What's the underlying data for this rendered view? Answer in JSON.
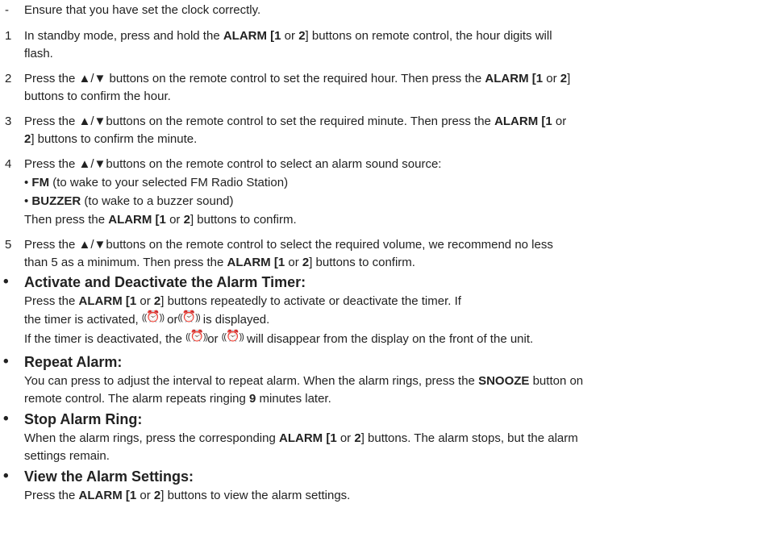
{
  "steps": {
    "prereq": {
      "marker": "-",
      "text": "Ensure that you have set the clock correctly."
    },
    "s1": {
      "marker": "1",
      "a": "In standby mode, press and hold the ",
      "b": "ALARM [1",
      "c": " or ",
      "d": "2",
      "e": "] buttons on remote control, the hour digits will",
      "f": "flash."
    },
    "s2": {
      "marker": "2",
      "a": "Press the ▲/▼ buttons on the remote control to set the required hour. Then press the ",
      "b": "ALARM [1",
      "c": " or ",
      "d": "2",
      "e": "]",
      "f": "buttons to confirm the hour."
    },
    "s3": {
      "marker": "3",
      "a": "Press the ▲/▼buttons on the remote control to set the required minute. Then press the ",
      "b": "ALARM [1",
      "c": " or",
      "d": "2",
      "e": "] buttons to confirm the minute."
    },
    "s4": {
      "marker": "4",
      "a": "Press the ▲/▼buttons on the remote control to select an alarm sound source:",
      "fm_bullet": "• ",
      "fm_label": "FM",
      "fm_text": " (to wake to your selected FM Radio Station)",
      "bz_bullet": "• ",
      "bz_label": "BUZZER",
      "bz_text": " (to wake to a buzzer sound)",
      "then_a": "Then press the ",
      "then_b": "ALARM [1",
      "then_c": " or ",
      "then_d": "2",
      "then_e": "] buttons to confirm."
    },
    "s5": {
      "marker": "5",
      "a": "Press the ▲/▼buttons on the remote control to select the required volume, we recommend no less",
      "b": "than 5 as a minimum. Then press the ",
      "c": "ALARM [1",
      "d": " or ",
      "e": "2",
      "f": "] buttons to confirm."
    }
  },
  "sections": {
    "activate": {
      "bullet": "•",
      "heading": "Activate and Deactivate the Alarm Timer:",
      "l1a": "Press the ",
      "l1b": "ALARM [1",
      "l1c": " or ",
      "l1d": "2",
      "l1e": "] buttons repeatedly to activate or deactivate the timer. If",
      "l2a": "the timer is activated, ",
      "l2b": " or",
      "l2c": " is displayed.",
      "l3a": "If the timer is deactivated, the ",
      "l3b": "or ",
      "l3c": " will disappear from the display on the front of the unit."
    },
    "repeat": {
      "bullet": "•",
      "heading": "Repeat Alarm:",
      "l1a": "You can press to adjust the interval to repeat alarm. When the alarm rings, press the ",
      "l1b": "SNOOZE",
      "l1c": " button on",
      "l2a": "remote control. The alarm repeats ringing ",
      "l2b": "9",
      "l2c": " minutes later."
    },
    "stop": {
      "bullet": "•",
      "heading": "Stop Alarm Ring:",
      "l1a": "When the alarm rings, press the corresponding ",
      "l1b": "ALARM [1",
      "l1c": " or ",
      "l1d": "2",
      "l1e": "] buttons. The alarm stops, but the alarm",
      "l2": "settings remain."
    },
    "view": {
      "bullet": "•",
      "heading": "View the Alarm Settings:",
      "l1a": "Press the ",
      "l1b": "ALARM [1",
      "l1c": " or ",
      "l1d": "2",
      "l1e": "] buttons to view the alarm settings."
    }
  },
  "icons": {
    "alarm1": "alarm-1-icon",
    "alarm2": "alarm-2-icon",
    "glyph1": "⏰",
    "glyph2": "⏰",
    "wave_left": "((",
    "wave_right": "))",
    "sub1": "1",
    "sub2": "2"
  }
}
